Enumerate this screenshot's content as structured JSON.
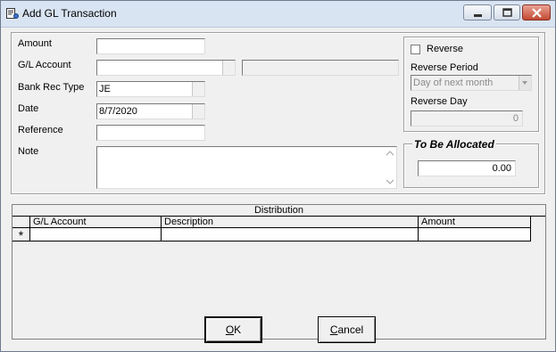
{
  "window": {
    "title": "Add GL Transaction",
    "icon": "app-icon"
  },
  "title_buttons": {
    "minimize": "minimize-icon",
    "maximize": "maximize-icon",
    "close": "close-icon"
  },
  "form": {
    "amount_label": "Amount",
    "amount_value": "",
    "gl_account_label": "G/L Account",
    "gl_account_value": "",
    "gl_account_desc": "",
    "bank_rec_type_label": "Bank Rec Type",
    "bank_rec_type_value": "JE",
    "date_label": "Date",
    "date_value": "8/7/2020",
    "reference_label": "Reference",
    "reference_value": "",
    "note_label": "Note",
    "note_value": ""
  },
  "reverse": {
    "checkbox_label": "Reverse",
    "checked": false,
    "period_label": "Reverse Period",
    "period_value": "Day of next month",
    "day_label": "Reverse Day",
    "day_value": "0"
  },
  "allocated": {
    "title": "To Be Allocated",
    "value": "0.00"
  },
  "distribution": {
    "caption": "Distribution",
    "columns": [
      "G/L Account",
      "Description",
      "Amount"
    ],
    "new_row_marker": "*"
  },
  "buttons": {
    "ok_prefix": "O",
    "ok_rest": "K",
    "cancel_prefix": "C",
    "cancel_rest": "ancel"
  }
}
